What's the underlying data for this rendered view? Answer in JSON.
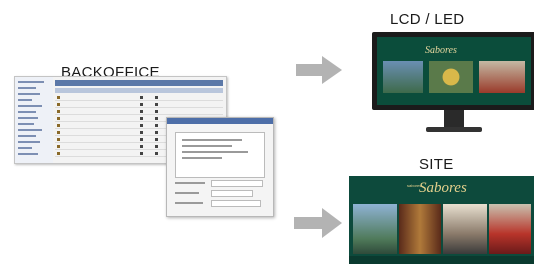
{
  "labels": {
    "backoffice": "BACKOFFICE",
    "lcd": "LCD / LED",
    "site": "SITE"
  },
  "monitor": {
    "logo_text": "Sabores"
  },
  "site": {
    "logo_text": "Sabores",
    "small_text": "sabores"
  },
  "colors": {
    "arrow": "#b3b3b3",
    "brand_green": "#0d4a3c",
    "brand_gold": "#e4d08c",
    "backoffice_blue": "#5b78a8"
  }
}
